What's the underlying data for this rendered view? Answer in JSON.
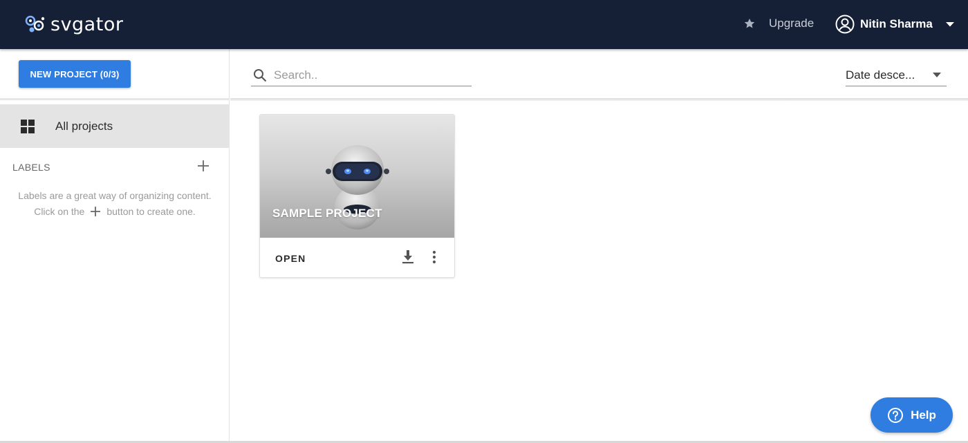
{
  "header": {
    "logo_text": "svgator",
    "upgrade_label": "Upgrade",
    "user_name": "Nitin Sharma",
    "icons": {
      "logo": "svgator-logo-icon",
      "upgrade": "star-icon",
      "user": "account-circle-icon",
      "menu": "chevron-down-icon"
    }
  },
  "sidebar": {
    "new_project_label": "NEW PROJECT (0/3)",
    "nav": [
      {
        "label": "All projects",
        "icon": "grid-icon",
        "active": true
      }
    ],
    "labels": {
      "title": "LABELS",
      "help_line1": "Labels are a great way of organizing content.",
      "help_line2_before": "Click on the",
      "help_line2_after": "button to create one."
    }
  },
  "toolbar": {
    "search_placeholder": "Search..",
    "sort_label": "Date desce..."
  },
  "projects": [
    {
      "title": "SAMPLE PROJECT",
      "open_label": "OPEN"
    }
  ],
  "help": {
    "label": "Help"
  },
  "colors": {
    "topbar": "#152036",
    "accent": "#2f7de1",
    "active_nav": "#e4e4e4"
  }
}
